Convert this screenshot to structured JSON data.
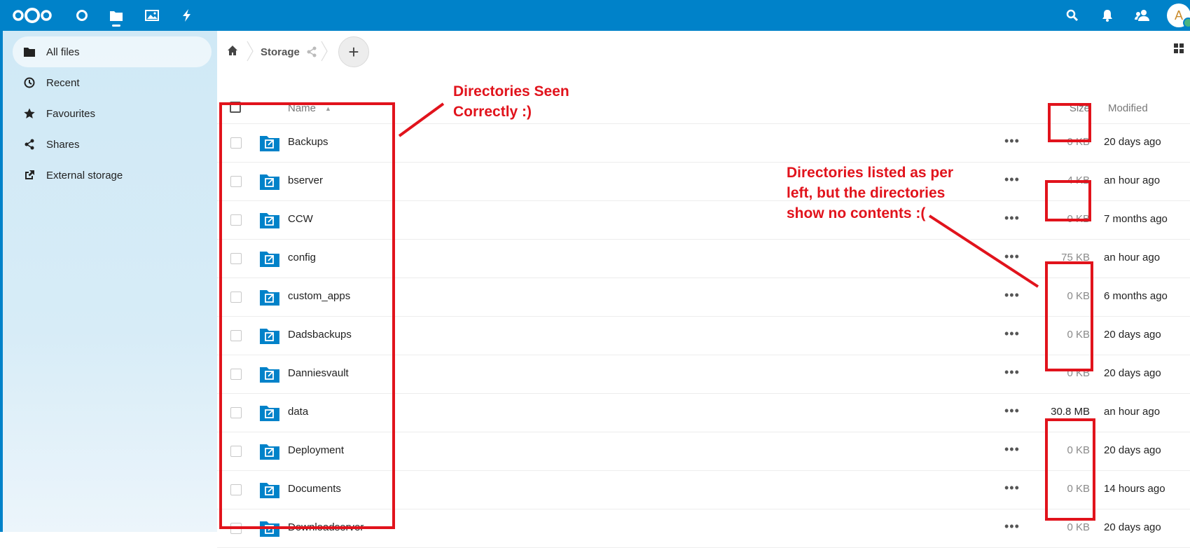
{
  "header": {
    "apps": [
      {
        "name": "logo-icon"
      },
      {
        "name": "dashboard-icon"
      },
      {
        "name": "files-icon",
        "active": true
      },
      {
        "name": "photos-icon"
      },
      {
        "name": "activity-icon"
      }
    ],
    "right_icons": [
      "search-icon",
      "notifications-icon",
      "contacts-icon"
    ],
    "avatar_letter": "A",
    "colors": {
      "brand": "#0082c9",
      "annotation": "#e1131c"
    }
  },
  "sidebar": {
    "items": [
      {
        "label": "All files",
        "icon": "folder-icon",
        "active": true
      },
      {
        "label": "Recent",
        "icon": "clock-icon"
      },
      {
        "label": "Favourites",
        "icon": "star-icon"
      },
      {
        "label": "Shares",
        "icon": "share-icon"
      },
      {
        "label": "External storage",
        "icon": "external-link-icon"
      }
    ]
  },
  "breadcrumb": {
    "home_icon": "home-icon",
    "current": "Storage"
  },
  "new_button_label": "+",
  "table": {
    "columns": {
      "name": "Name",
      "size": "Size",
      "modified": "Modified"
    },
    "rows": [
      {
        "name": "Backups",
        "size": "0 KB",
        "modified": "20 days ago"
      },
      {
        "name": "bserver",
        "size": "4 KB",
        "modified": "an hour ago"
      },
      {
        "name": "CCW",
        "size": "0 KB",
        "modified": "7 months ago"
      },
      {
        "name": "config",
        "size": "75 KB",
        "modified": "an hour ago"
      },
      {
        "name": "custom_apps",
        "size": "0 KB",
        "modified": "6 months ago"
      },
      {
        "name": "Dadsbackups",
        "size": "0 KB",
        "modified": "20 days ago"
      },
      {
        "name": "Danniesvault",
        "size": "0 KB",
        "modified": "20 days ago"
      },
      {
        "name": "data",
        "size": "30.8 MB",
        "modified": "an hour ago"
      },
      {
        "name": "Deployment",
        "size": "0 KB",
        "modified": "20 days ago"
      },
      {
        "name": "Documents",
        "size": "0 KB",
        "modified": "14 hours ago"
      },
      {
        "name": "Downloadserver",
        "size": "0 KB",
        "modified": "20 days ago"
      }
    ]
  },
  "annotations": {
    "left_note": [
      "Directories Seen",
      "Correctly :)"
    ],
    "right_note": [
      "Directories listed as per",
      "left, but the directories",
      "show no contents :("
    ]
  }
}
